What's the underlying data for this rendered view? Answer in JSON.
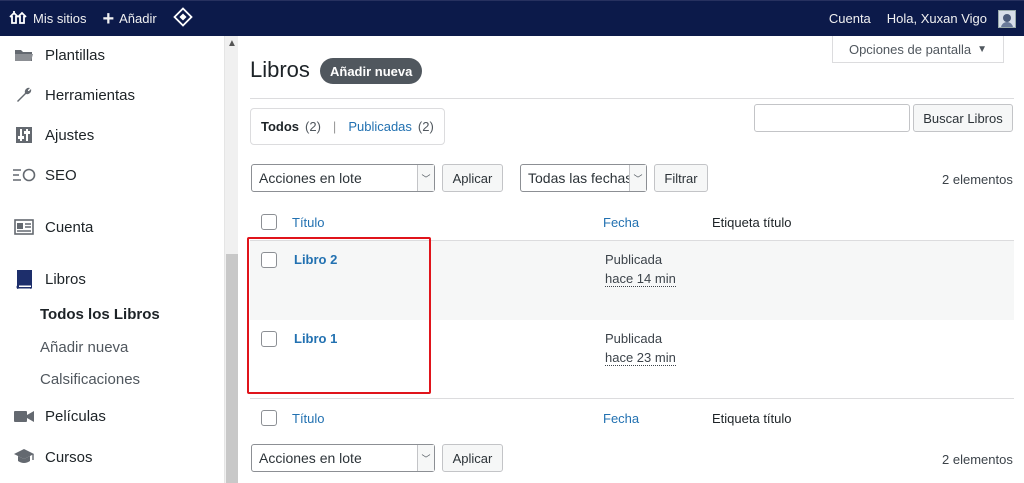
{
  "adminbar": {
    "my_sites": "Mis sitios",
    "add": "Añadir",
    "account": "Cuenta",
    "greeting": "Hola, Xuxan Vigo"
  },
  "sidebar": {
    "items": [
      {
        "label": "Plantillas",
        "icon": "folder-icon"
      },
      {
        "label": "Herramientas",
        "icon": "wrench-icon"
      },
      {
        "label": "Ajustes",
        "icon": "settings-sliders-icon"
      },
      {
        "label": "SEO",
        "icon": "seo-icon"
      },
      {
        "label": "Cuenta",
        "icon": "account-card-icon"
      },
      {
        "label": "Libros",
        "icon": "book-icon"
      },
      {
        "label": "Películas",
        "icon": "video-camera-icon"
      },
      {
        "label": "Cursos",
        "icon": "graduation-cap-icon"
      }
    ],
    "submenu": [
      "Todos los Libros",
      "Añadir nueva",
      "Calsificaciones"
    ]
  },
  "screen_options": "Opciones de pantalla",
  "page": {
    "title": "Libros",
    "add_new": "Añadir nueva"
  },
  "views": {
    "all_label": "Todos",
    "all_count": "(2)",
    "published_label": "Publicadas",
    "published_count": "(2)"
  },
  "search": {
    "button": "Buscar Libros"
  },
  "tablenav": {
    "bulk_actions": "Acciones en lote",
    "apply": "Aplicar",
    "dates": "Todas las fechas",
    "filter": "Filtrar",
    "items_count": "2 elementos"
  },
  "table": {
    "columns": [
      "Título",
      "Fecha",
      "Etiqueta título"
    ],
    "rows": [
      {
        "title": "Libro 2",
        "status": "Publicada",
        "time": "hace 14 min"
      },
      {
        "title": "Libro 1",
        "status": "Publicada",
        "time": "hace 23 min"
      }
    ]
  },
  "colors": {
    "adminbar": "#0c1a4a",
    "link": "#2271b1",
    "highlight": "#e0141b"
  }
}
